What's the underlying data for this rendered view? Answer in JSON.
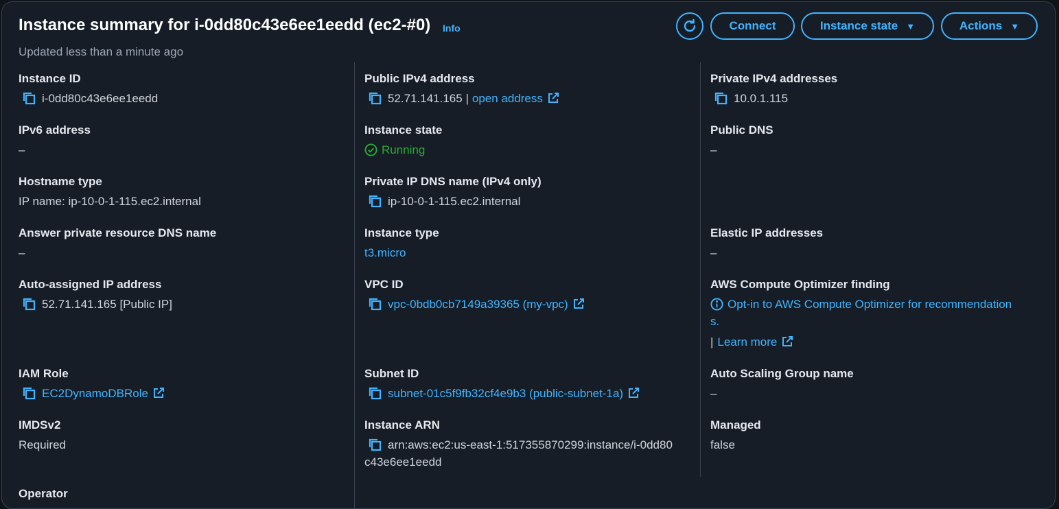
{
  "header": {
    "title": "Instance summary for i-0dd80c43e6ee1eedd (ec2-#0)",
    "info": "Info",
    "updated": "Updated less than a minute ago",
    "buttons": {
      "connect": "Connect",
      "instance_state": "Instance state",
      "actions": "Actions"
    }
  },
  "colors": {
    "accent": "#42b4ff",
    "running": "#29ad32",
    "background": "#161d26"
  },
  "col1": {
    "instance_id": {
      "label": "Instance ID",
      "value": "i-0dd80c43e6ee1eedd"
    },
    "ipv6": {
      "label": "IPv6 address",
      "value": "–"
    },
    "hostname_type": {
      "label": "Hostname type",
      "value": "IP name: ip-10-0-1-115.ec2.internal"
    },
    "answer_dns": {
      "label": "Answer private resource DNS name",
      "value": "–"
    },
    "auto_ip": {
      "label": "Auto-assigned IP address",
      "value": "52.71.141.165 [Public IP]"
    },
    "iam_role": {
      "label": "IAM Role",
      "value": "EC2DynamoDBRole"
    },
    "imdsv2": {
      "label": "IMDSv2",
      "value": "Required"
    },
    "operator": {
      "label": "Operator"
    }
  },
  "col2": {
    "public_ipv4": {
      "label": "Public IPv4 address",
      "value": "52.71.141.165 |",
      "link": "open address"
    },
    "instance_state": {
      "label": "Instance state",
      "value": "Running"
    },
    "private_dns": {
      "label": "Private IP DNS name (IPv4 only)",
      "value": "ip-10-0-1-115.ec2.internal"
    },
    "instance_type": {
      "label": "Instance type",
      "value": "t3.micro"
    },
    "vpc_id": {
      "label": "VPC ID",
      "value": "vpc-0bdb0cb7149a39365 (my-vpc)"
    },
    "subnet_id": {
      "label": "Subnet ID",
      "value": "subnet-01c5f9fb32cf4e9b3 (public-subnet-1a)"
    },
    "arn": {
      "label": "Instance ARN",
      "line1": "arn:aws:ec2:us-east-1:517355870299:instance/i-0dd80",
      "line2": "c43e6ee1eedd"
    }
  },
  "col3": {
    "private_ipv4": {
      "label": "Private IPv4 addresses",
      "value": "10.0.1.115"
    },
    "public_dns": {
      "label": "Public DNS",
      "value": "–"
    },
    "elastic_ip": {
      "label": "Elastic IP addresses",
      "value": "–"
    },
    "optimizer": {
      "label": "AWS Compute Optimizer finding",
      "line1": "Opt-in to AWS Compute Optimizer for recommendation",
      "line2": "s.",
      "sep": "|",
      "learn_more": "Learn more"
    },
    "asg": {
      "label": "Auto Scaling Group name",
      "value": "–"
    },
    "managed": {
      "label": "Managed",
      "value": "false"
    }
  }
}
